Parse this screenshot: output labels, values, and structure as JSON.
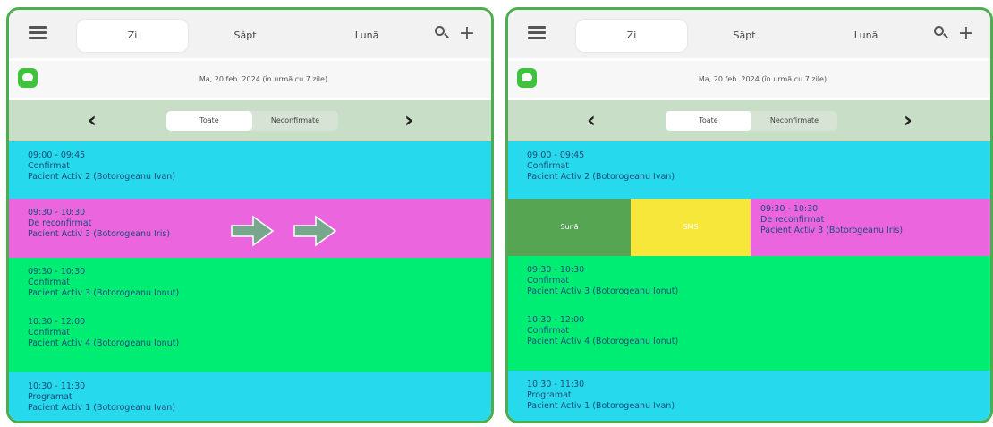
{
  "colors": {
    "frame": "#4cae4f",
    "status_confirmed": "#00ed74",
    "status_scheduled": "#27d9ec",
    "status_reconfirm": "#eb66de",
    "call_button": "#55a552",
    "sms_button": "#f6e73a"
  },
  "header": {
    "menu_icon": "hamburger-menu-icon",
    "tabs": [
      {
        "label": "Zi",
        "active": true
      },
      {
        "label": "Săpt",
        "active": false
      },
      {
        "label": "Lună",
        "active": false
      }
    ],
    "search_icon": "search-icon",
    "add_label": "+"
  },
  "date_row": {
    "chat_icon": "chat-icon",
    "text": "Ma, 20 feb. 2024 (în urmă cu 7 zile)"
  },
  "filter_row": {
    "prev_label": "‹",
    "next_label": "›",
    "options": [
      "Toate",
      "Neconfirmate"
    ],
    "selected": "Toate"
  },
  "appointments": [
    {
      "time": "09:00 - 09:45",
      "status": "Confirmat",
      "patient": "Pacient Activ 2 (Botorogeanu  Ivan)"
    },
    {
      "time": "09:30 - 10:30",
      "status": "De reconfirmat",
      "patient": "Pacient Activ 3 (Botorogeanu Iris)"
    },
    {
      "time": "09:30 - 10:30",
      "status": "Confirmat",
      "patient": "Pacient Activ 3 (Botorogeanu Ionut)"
    },
    {
      "time": "10:30 - 12:00",
      "status": "Confirmat",
      "patient": "Pacient Activ 4 (Botorogeanu Ionut)"
    },
    {
      "time": "10:30 - 11:30",
      "status": "Programat",
      "patient": "Pacient Activ 1 (Botorogeanu  Ivan)"
    }
  ],
  "swipe_hint_icon": "swipe-right-arrows-icon",
  "swipe_actions": {
    "call_label": "Sună",
    "sms_label": "SMS"
  }
}
